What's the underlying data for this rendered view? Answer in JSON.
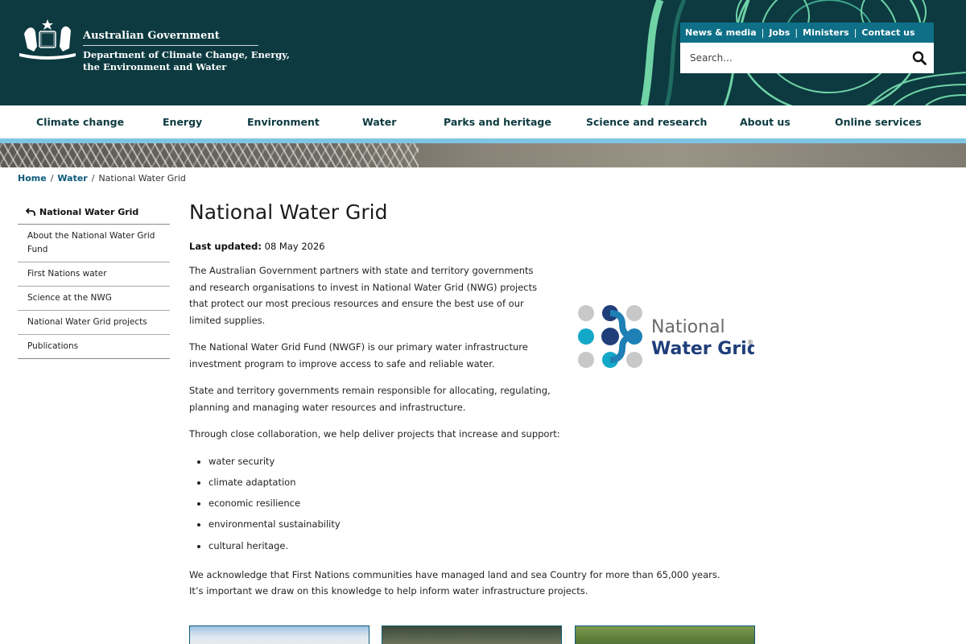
{
  "header": {
    "gov_title": "Australian Government",
    "dept_line1": "Department of Climate Change, Energy,",
    "dept_line2": "the Environment and Water",
    "utility_links": [
      "News & media",
      "Jobs",
      "Ministers",
      "Contact us"
    ],
    "search_placeholder": "Search...",
    "colors": {
      "header_bg": "#0c3a40",
      "utility_bg": "#0e6f87",
      "accent_green": "#6fd3a6",
      "nav_stripe": "#7dc5e3"
    }
  },
  "nav": {
    "items": [
      "Climate change",
      "Energy",
      "Environment",
      "Water",
      "Parks and heritage",
      "Science and research",
      "About us",
      "Online services"
    ]
  },
  "breadcrumb": {
    "items": [
      "Home",
      "Water",
      "National Water Grid"
    ]
  },
  "sidebar": {
    "heading": "National Water Grid",
    "items": [
      "About the National Water Grid Fund",
      "First Nations water",
      "Science at the NWG",
      "National Water Grid projects",
      "Publications"
    ]
  },
  "main": {
    "title": "National Water Grid",
    "updated_label": "Last updated:",
    "updated_date": "08 May 2026",
    "para1": "The Australian Government partners with state and territory governments and research organisations to invest in National Water Grid (NWG) projects that protect our most precious resources and ensure the best use of our limited supplies.",
    "para2": "The National Water Grid Fund (NWGF) is our primary water infrastructure investment program to improve access to safe and reliable water.",
    "para3": "State and territory governments remain responsible for allocating, regulating, planning and managing water resources and infrastructure.",
    "para4": "Through close collaboration, we help deliver projects that increase and support:",
    "bullets": [
      "water security",
      "climate adaptation",
      "economic resilience",
      "environmental sustainability",
      "cultural heritage."
    ],
    "para5": "We acknowledge that First Nations communities have managed land and sea Country for more than 65,000 years. It’s important we draw on this knowledge to help inform water infrastructure projects.",
    "logo": {
      "line1": "National",
      "line2": "Water Grid",
      "mark": "®"
    }
  }
}
